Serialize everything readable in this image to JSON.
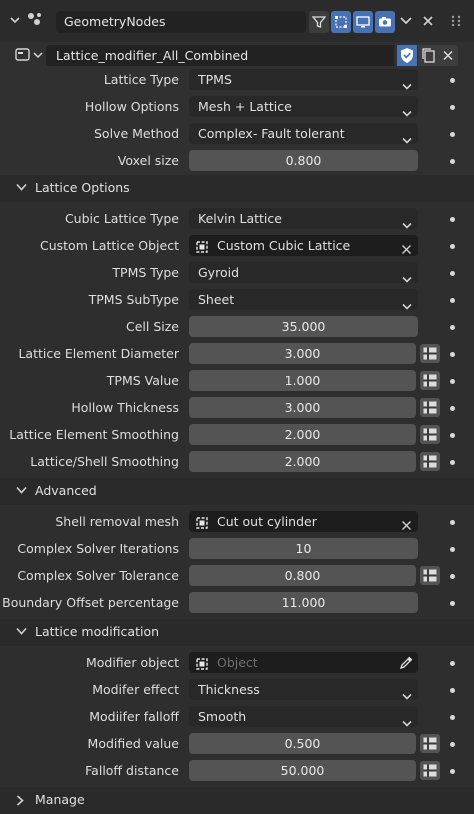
{
  "header": {
    "modifier_name": "GeometryNodes"
  },
  "node_group": {
    "name": "Lattice_modifier_All_Combined"
  },
  "main": [
    {
      "label": "Lattice Type",
      "type": "enum",
      "value": "TPMS"
    },
    {
      "label": "Hollow Options",
      "type": "enum",
      "value": "Mesh + Lattice"
    },
    {
      "label": "Solve Method",
      "type": "enum",
      "value": "Complex- Fault tolerant"
    },
    {
      "label": "Voxel size",
      "type": "num",
      "value": "0.800"
    }
  ],
  "sections": {
    "lattice_options": {
      "title": "Lattice Options"
    },
    "advanced": {
      "title": "Advanced"
    },
    "lattice_modification": {
      "title": "Lattice modification"
    },
    "manage": {
      "title": "Manage"
    }
  },
  "lattice_options": [
    {
      "label": "Cubic Lattice Type",
      "type": "enum",
      "value": "Kelvin Lattice"
    },
    {
      "label": "Custom Lattice Object",
      "type": "obj",
      "value": "Custom Cubic Lattice"
    },
    {
      "label": "TPMS Type",
      "type": "enum",
      "value": "Gyroid"
    },
    {
      "label": "TPMS SubType",
      "type": "enum",
      "value": "Sheet"
    },
    {
      "label": "Cell Size",
      "type": "num",
      "value": "35.000"
    },
    {
      "label": "Lattice Element Diameter",
      "type": "numkey",
      "value": "3.000"
    },
    {
      "label": "TPMS Value",
      "type": "numkey",
      "value": "1.000"
    },
    {
      "label": "Hollow Thickness",
      "type": "numkey",
      "value": "3.000"
    },
    {
      "label": "Lattice Element Smoothing",
      "type": "numkey",
      "value": "2.000"
    },
    {
      "label": "Lattice/Shell Smoothing",
      "type": "numkey",
      "value": "2.000"
    }
  ],
  "advanced": [
    {
      "label": "Shell removal mesh",
      "type": "obj",
      "value": "Cut out cylinder"
    },
    {
      "label": "Complex Solver Iterations",
      "type": "num",
      "value": "10"
    },
    {
      "label": "Complex Solver Tolerance",
      "type": "numkey",
      "value": "0.800"
    },
    {
      "label": "Boundary Offset percentage",
      "type": "num",
      "value": "11.000"
    }
  ],
  "lattice_modification": [
    {
      "label": "Modifier object",
      "type": "objempty",
      "placeholder": "Object"
    },
    {
      "label": "Modifer effect",
      "type": "enum",
      "value": "Thickness"
    },
    {
      "label": "Modiifer falloff",
      "type": "enum",
      "value": "Smooth"
    },
    {
      "label": "Modified value",
      "type": "numkey",
      "value": "0.500"
    },
    {
      "label": "Falloff distance",
      "type": "numkey",
      "value": "50.000"
    }
  ]
}
